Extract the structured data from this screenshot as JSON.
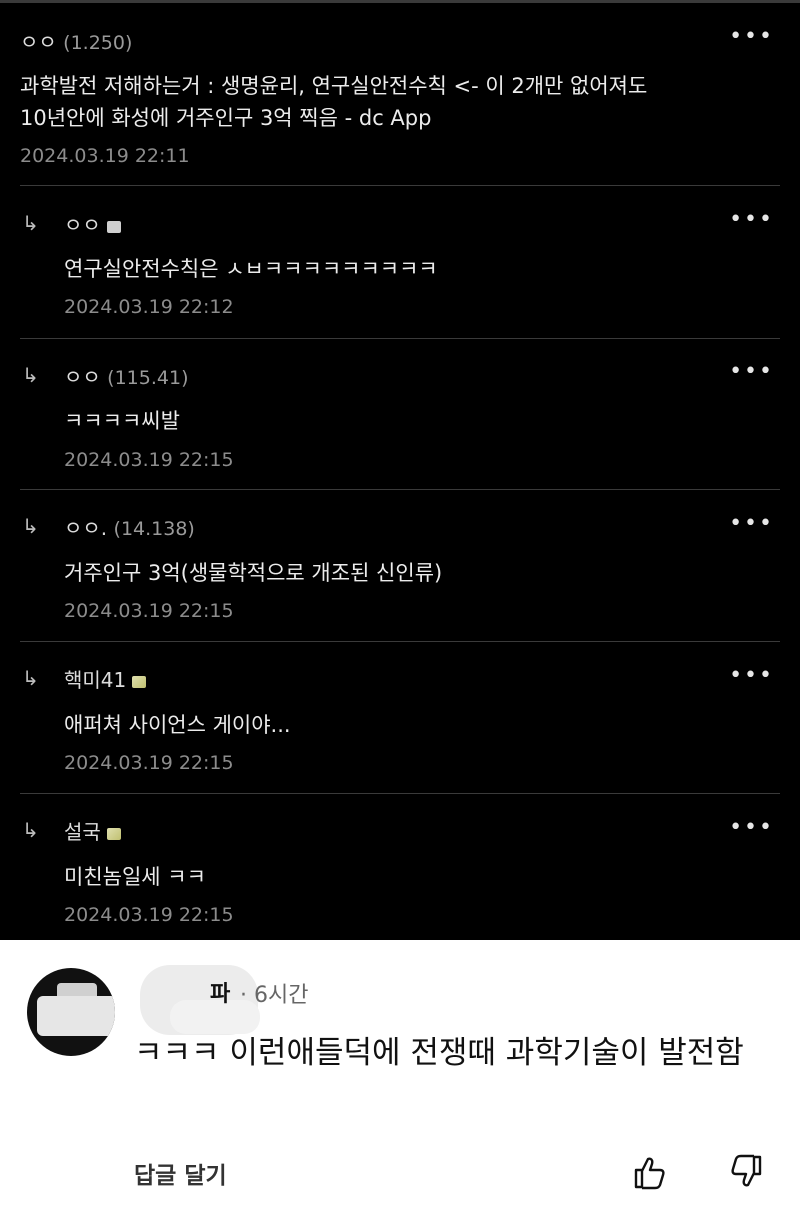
{
  "post": {
    "nick": "ㅇㅇ",
    "ip": "(1.250)",
    "body_line1": "과학발전 저해하는거 : 생명윤리, 연구실안전수칙 <- 이 2개만 없어져도",
    "body_line2": "10년안에 화성에 거주인구 3억 찍음 - dc App",
    "date": "2024.03.19 22:11"
  },
  "replies": [
    {
      "nick": "ㅇㅇ",
      "ip": "",
      "body": "연구실안전수칙은 ㅅㅂㅋㅋㅋㅋㅋㅋㅋㅋㅋ",
      "date": "2024.03.19 22:12"
    },
    {
      "nick": "ㅇㅇ",
      "ip": "(115.41)",
      "body": "ㅋㅋㅋㅋ씨발",
      "date": "2024.03.19 22:15"
    },
    {
      "nick": "ㅇㅇ.",
      "ip": "(14.138)",
      "body": "거주인구 3억(생물학적으로 개조된 신인류)",
      "date": "2024.03.19 22:15"
    },
    {
      "nick": "핵미41",
      "ip": "",
      "body": "애퍼쳐 사이언스 게이야...",
      "date": "2024.03.19 22:15"
    },
    {
      "nick": "설국",
      "ip": "",
      "body": "미친놈일세 ㅋㅋ",
      "date": "2024.03.19 22:15"
    }
  ],
  "comment": {
    "name": "파",
    "time": "· 6시간",
    "text": "ㅋㅋㅋ 이런애들덕에 전쟁때 과학기술이 발전함",
    "reply_label": "답글 달기"
  },
  "icons": {
    "more": "more-dots-icon",
    "reply_arrow": "reply-arrow-icon",
    "like": "thumbs-up-icon",
    "dislike": "thumbs-down-icon"
  }
}
